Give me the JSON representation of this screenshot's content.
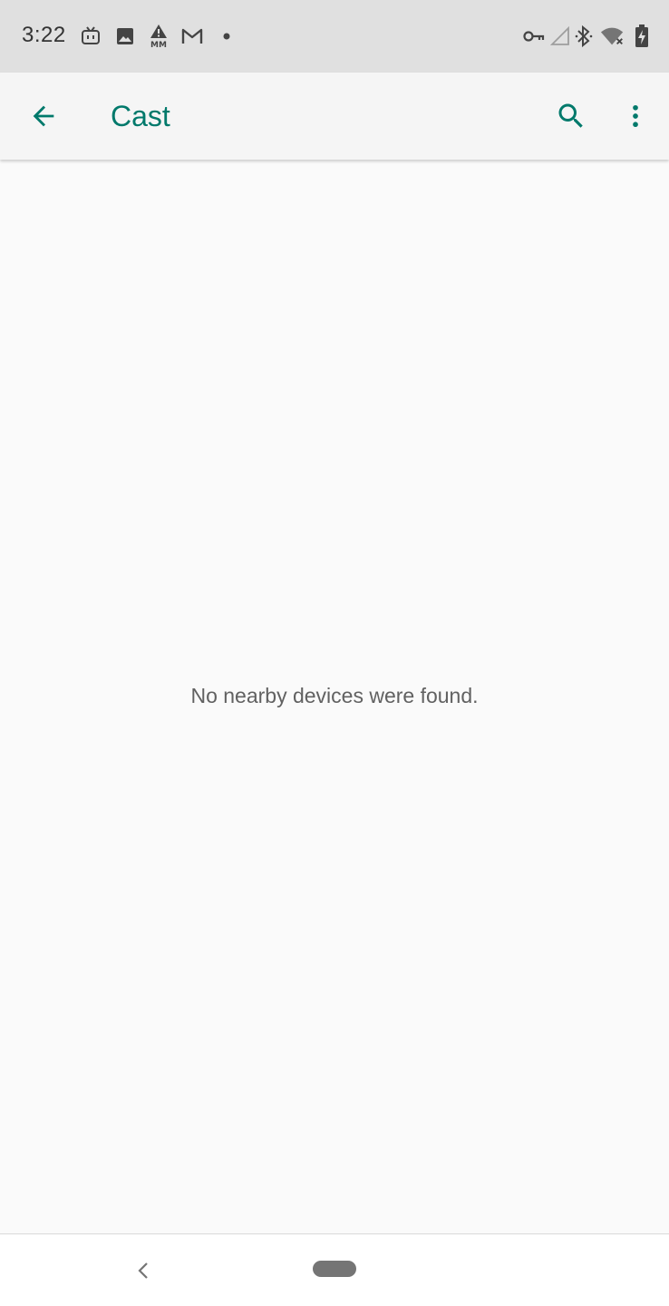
{
  "status_bar": {
    "time": "3:22",
    "left_icons": [
      "tv-app-icon",
      "image-icon",
      "mm-alert-icon",
      "gmail-icon",
      "dot-icon"
    ],
    "right_icons": [
      "vpn-key-icon",
      "cell-signal-icon",
      "bluetooth-icon",
      "wifi-off-icon",
      "battery-charging-icon"
    ]
  },
  "app_bar": {
    "title": "Cast",
    "back_icon": "arrow-back-icon",
    "search_icon": "search-icon",
    "more_icon": "more-vert-icon",
    "accent_color": "#00796b"
  },
  "content": {
    "empty_message": "No nearby devices were found."
  },
  "nav_bar": {
    "back_icon": "chevron-left-icon",
    "home_icon": "home-pill-icon"
  }
}
